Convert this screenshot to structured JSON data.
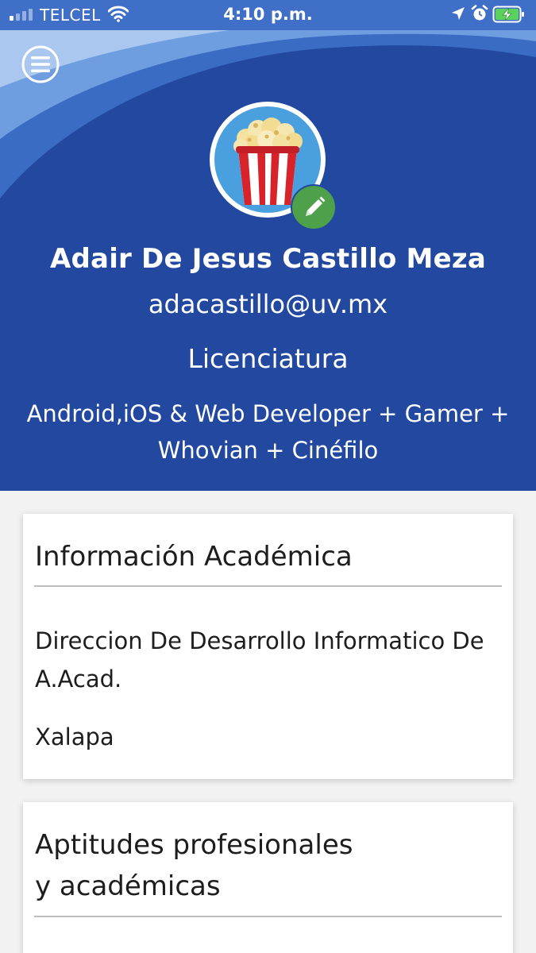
{
  "status_bar": {
    "carrier": "TELCEL",
    "time": "4:10 p.m.",
    "signal_bars_active": 1,
    "signal_bars_total": 4,
    "battery_charging": true
  },
  "header": {
    "background_color": "#2248a0",
    "menu_icon": "hamburger-menu-icon",
    "avatar_icon": "popcorn-bucket-icon",
    "edit_icon": "pencil-icon"
  },
  "profile": {
    "name": "Adair De Jesus Castillo Meza",
    "email": "adacastillo@uv.mx",
    "degree": "Licenciatura",
    "bio": "Android,iOS & Web Developer + Gamer + Whovian + Cinéfilo"
  },
  "academic_card": {
    "title": "Información Académica",
    "department": "Direccion De Desarrollo Informatico De A.Acad.",
    "location": "Xalapa"
  },
  "skills_card": {
    "title": "Aptitudes profesionales y académicas"
  }
}
